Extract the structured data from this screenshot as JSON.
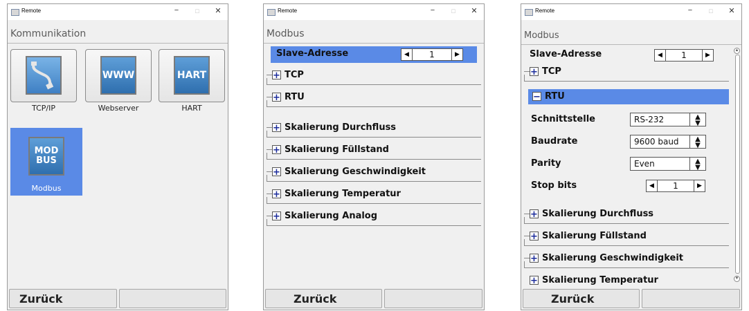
{
  "window1": {
    "title": "Remote",
    "heading": "Kommunikation",
    "tiles": [
      {
        "label": "TCP/IP",
        "icon_text": ""
      },
      {
        "label": "Webserver",
        "icon_text": "WWW"
      },
      {
        "label": "HART",
        "icon_text": "HART"
      },
      {
        "label": "Modbus",
        "icon_text": "MOD\nBUS"
      }
    ],
    "footer": {
      "back": "Zurück",
      "right": ""
    }
  },
  "window2": {
    "title": "Remote",
    "heading": "Modbus",
    "slave": {
      "label": "Slave-Adresse",
      "value": "1"
    },
    "groups": [
      "TCP",
      "RTU",
      "Skalierung Durchfluss",
      "Skalierung Füllstand",
      "Skalierung Geschwindigkeit",
      "Skalierung Temperatur",
      "Skalierung Analog"
    ],
    "footer": {
      "back": "Zurück",
      "right": ""
    }
  },
  "window3": {
    "title": "Remote",
    "heading": "Modbus",
    "slave": {
      "label": "Slave-Adresse",
      "value": "1"
    },
    "tcp": "TCP",
    "rtu": "RTU",
    "fields": {
      "schnittstelle": {
        "label": "Schnittstelle",
        "value": "RS-232"
      },
      "baudrate": {
        "label": "Baudrate",
        "value": "9600 baud"
      },
      "parity": {
        "label": "Parity",
        "value": "Even"
      },
      "stopbits": {
        "label": "Stop bits",
        "value": "1"
      }
    },
    "groups": [
      "Skalierung Durchfluss",
      "Skalierung Füllstand",
      "Skalierung Geschwindigkeit",
      "Skalierung Temperatur"
    ],
    "footer": {
      "back": "Zurück",
      "right": ""
    }
  },
  "colors": {
    "accent": "#5a8ae6",
    "icon_blue": "#3f80c4"
  },
  "icons": {
    "minimize": "−",
    "maximize": "□",
    "close": "✕",
    "expand": "+",
    "collapse": "−",
    "left": "◀",
    "right": "▶",
    "updown": "▲▼"
  }
}
